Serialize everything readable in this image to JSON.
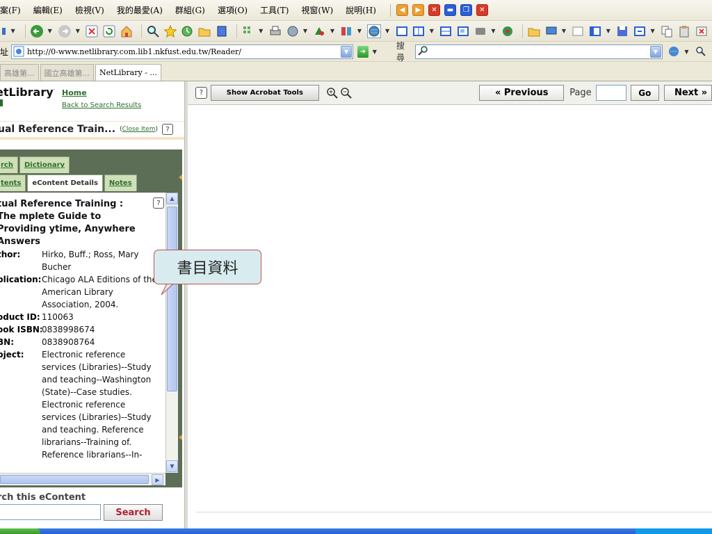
{
  "menubar": {
    "items": [
      "案(F)",
      "編輯(E)",
      "檢視(V)",
      "我的最愛(A)",
      "群組(G)",
      "選項(O)",
      "工具(T)",
      "視窗(W)",
      "說明(H)"
    ]
  },
  "address": {
    "label": "址",
    "url": "http://0-www.netlibrary.com.lib1.nkfust.edu.tw/Reader/"
  },
  "search_bar": {
    "label": "搜尋",
    "value": ""
  },
  "tabs": [
    "高雄第...",
    "國立高雄第...",
    "NetLibrary - ..."
  ],
  "netlibrary": {
    "logo": "etLibrary",
    "home": "Home",
    "back": "Back to Search Results",
    "item_title": "ual Reference Train...",
    "close_item": "Close Item",
    "tabs_row1": [
      "rch",
      "Dictionary"
    ],
    "tabs_row2": [
      "tents",
      "eContent Details",
      "Notes"
    ],
    "details": {
      "title": "tual Reference Training : The mplete Guide to Providing ytime, Anywhere Answers",
      "rows": [
        {
          "label": "thor:",
          "value": "Hirko, Buff.; Ross, Mary Bucher"
        },
        {
          "label": "blication:",
          "value": "Chicago ALA Editions of the American Library Association, 2004."
        },
        {
          "label": "oduct ID:",
          "value": "110063"
        },
        {
          "label": "ook ISBN:",
          "value": "0838998674"
        },
        {
          "label": "BN:",
          "value": "0838908764"
        },
        {
          "label": "bject:",
          "value": "Electronic reference services (Libraries)--Study and teaching--Washington (State)--Case studies. Electronic reference services (Libraries)--Study and teaching. Reference librarians--Training of. Reference librarians--In-"
        }
      ]
    },
    "search_label": "rch this eContent",
    "search_value": "",
    "search_button": "Search"
  },
  "reader": {
    "acrobat": "Show Acrobat Tools",
    "previous": "« Previous",
    "page_label": "Page",
    "page_value": "",
    "go": "Go",
    "next": "Next »"
  },
  "callout": {
    "text": "書目資料"
  },
  "colors": {
    "accent_green": "#2c6e2c",
    "panel_green": "#5d6e56",
    "callout_border": "#c0504d",
    "callout_fill": "#d8ecef"
  }
}
